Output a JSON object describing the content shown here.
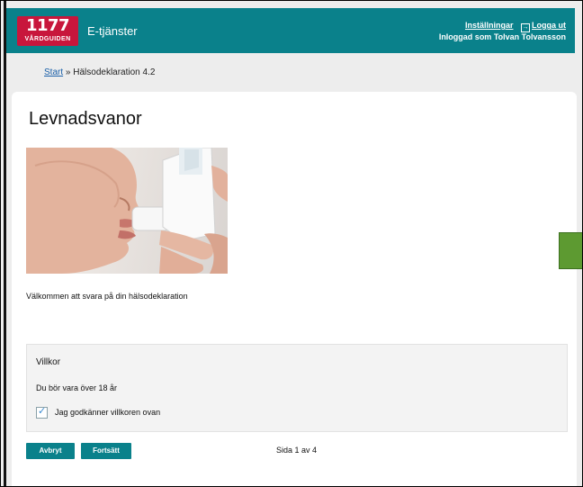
{
  "header": {
    "logo_number": "1177",
    "logo_subtitle": "VÅRDGUIDEN",
    "service_title": "E-tjänster",
    "settings_link": "Inställningar",
    "logout_link": "Logga ut",
    "logged_in_text": "Inloggad som Tolvan Tolvansson"
  },
  "breadcrumb": {
    "home": "Start",
    "separator": "»",
    "current": "Hälsodeklaration 4.2"
  },
  "main": {
    "page_title": "Levnadsvanor",
    "welcome_text": "Välkommen att svara på din hälsodeklaration"
  },
  "terms": {
    "title": "Villkor",
    "text": "Du bör vara över 18 år",
    "checkbox_label": "Jag godkänner villkoren ovan",
    "checkbox_checked": true
  },
  "actions": {
    "cancel_label": "Avbryt",
    "continue_label": "Fortsätt",
    "page_counter": "Sida 1 av 4"
  },
  "colors": {
    "header_teal": "#0a818b",
    "logo_red": "#c8163c",
    "marker_green": "#5d9a31"
  },
  "icons": {
    "logout": "logout-icon",
    "check": "checkmark-icon"
  }
}
